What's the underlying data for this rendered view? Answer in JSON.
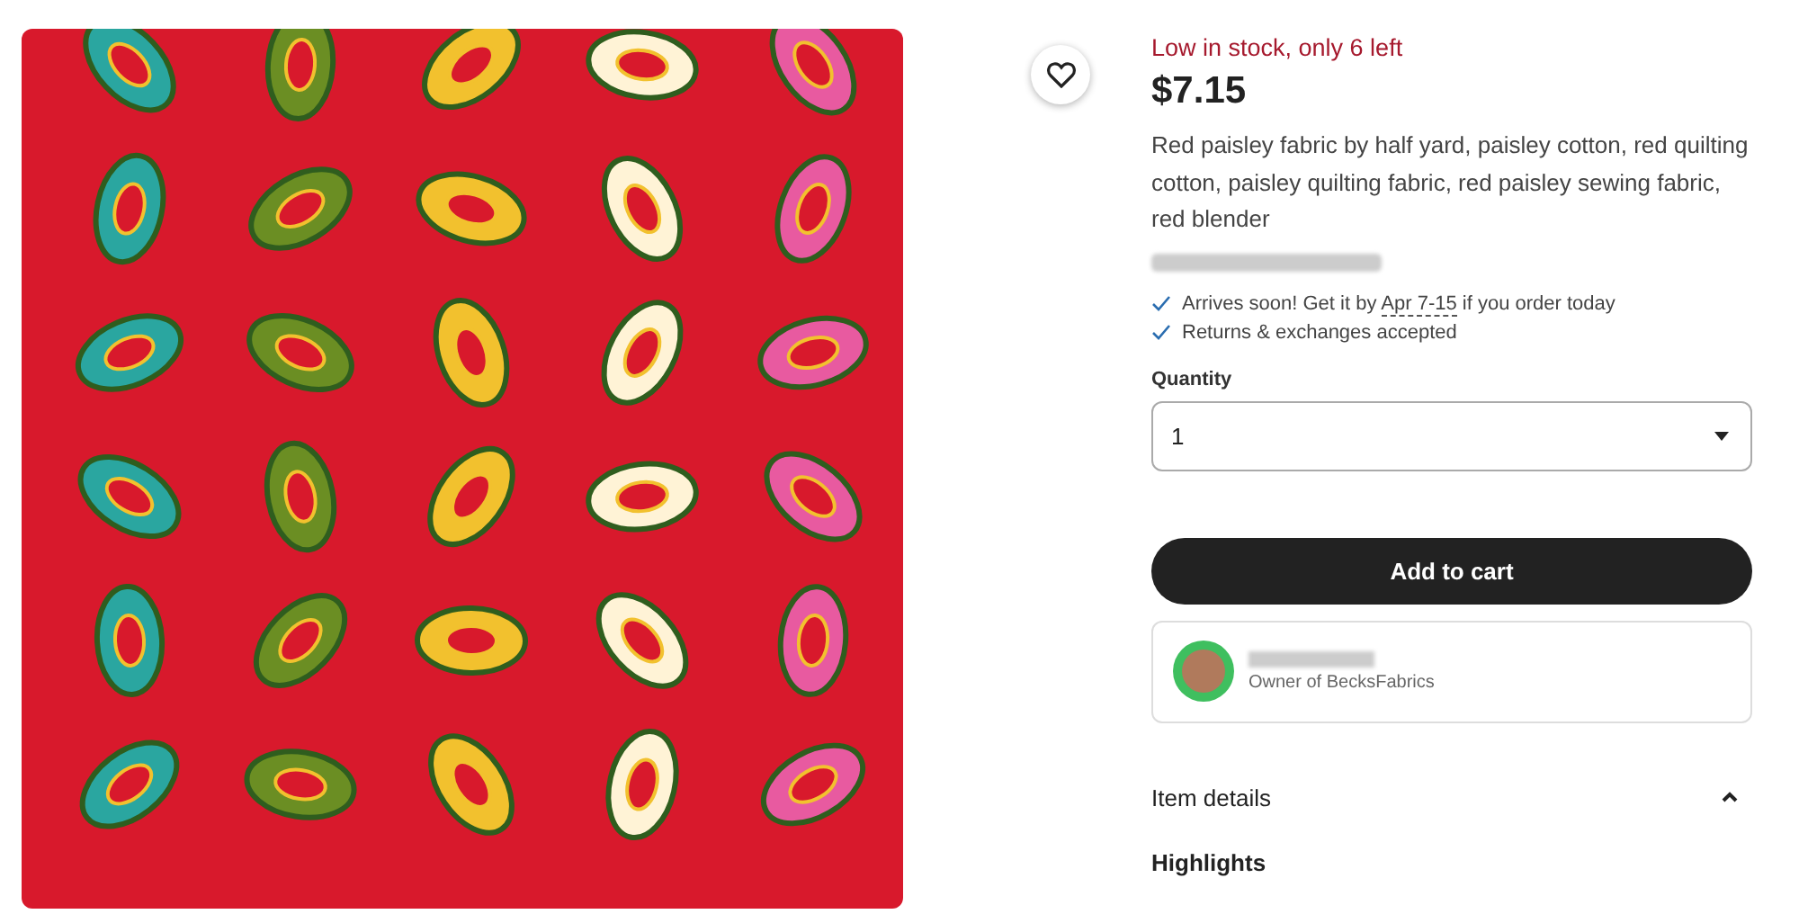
{
  "listing": {
    "stock_notice": "Low in stock, only 6 left",
    "price": "$7.15",
    "title": "Red paisley fabric by half yard, paisley cotton, red quilting cotton, paisley quilting fabric, red paisley sewing fabric, red blender",
    "perks": [
      {
        "before": "Arrives soon! Get it by ",
        "date": "Apr 7-15",
        "after": " if you order today"
      },
      {
        "before": "Returns & exchanges accepted"
      }
    ],
    "quantity": {
      "label": "Quantity",
      "value": "1"
    },
    "add_to_cart": "Add to cart",
    "seller": {
      "subtitle": "Owner of BecksFabrics"
    },
    "item_details": {
      "label": "Item details",
      "expanded": true
    },
    "highlights": "Highlights"
  }
}
